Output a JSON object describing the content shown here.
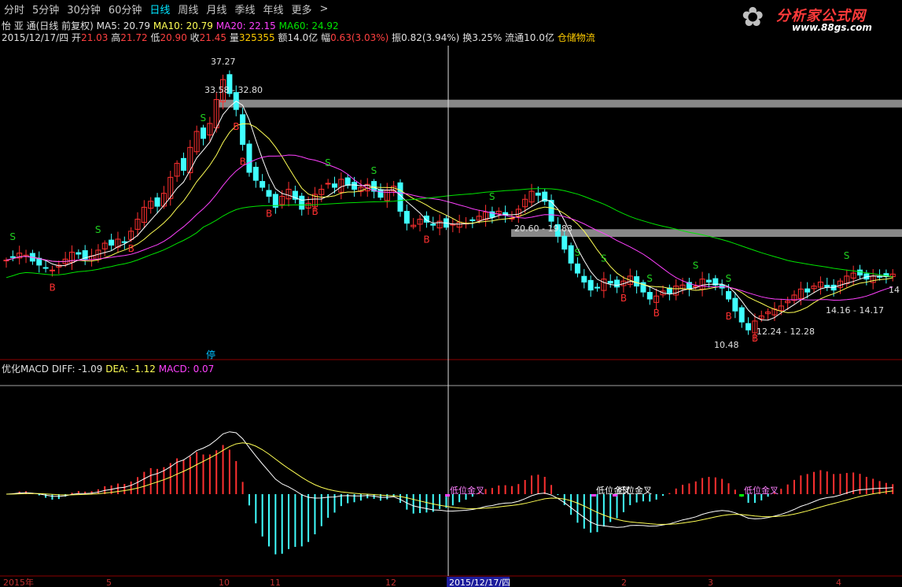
{
  "tabs": [
    {
      "label": "分时",
      "active": false
    },
    {
      "label": "5分钟",
      "active": false
    },
    {
      "label": "30分钟",
      "active": false
    },
    {
      "label": "60分钟",
      "active": false
    },
    {
      "label": "日线",
      "active": true
    },
    {
      "label": "周线",
      "active": false
    },
    {
      "label": "月线",
      "active": false
    },
    {
      "label": "季线",
      "active": false
    },
    {
      "label": "年线",
      "active": false
    },
    {
      "label": "更多",
      "active": false
    },
    {
      "label": ">",
      "active": false
    }
  ],
  "logo": {
    "title": "分析家公式网",
    "url": "www.88gs.com"
  },
  "stock": {
    "name_line": "怡 亚 通(日线 前复权)",
    "ma5": "MA5: 20.79",
    "ma10": "MA10: 20.79",
    "ma20": "MA20: 22.15",
    "ma60": "MA60: 24.92",
    "date": "2015/12/17/四",
    "open_label": "开",
    "open": "21.03",
    "high_label": "高",
    "high": "21.72",
    "low_label": "低",
    "low": "20.90",
    "close_label": "收",
    "close": "21.45",
    "vol_label": "量",
    "vol": "325355",
    "amt_label": "额",
    "amt": "14.0亿",
    "chg_label": "幅",
    "chg": "0.63(3.03%)",
    "amp_label": "振",
    "amp": "0.82(3.94%)",
    "turn_label": "换",
    "turn": "3.25%",
    "float_label": "流通",
    "float": "10.0亿",
    "sector": "仓储物流"
  },
  "macd": {
    "name": "优化MACD",
    "diff": "DIFF: -1.09",
    "dea": "DEA: -1.12",
    "macd": "MACD: 0.07"
  },
  "colors": {
    "up": "#ff3030",
    "down": "#40ffff",
    "ma5": "#ffffff",
    "ma10": "#ffff54",
    "ma20": "#ff40ff",
    "ma60": "#00e400",
    "zone": "#a0a0a0"
  },
  "chart_data": {
    "type": "candlestick",
    "axis_labels": [
      "2015年",
      "5",
      "10",
      "11",
      "12",
      "2015/12/17/四",
      "2",
      "3",
      "4"
    ],
    "price_annotations": [
      "37.27",
      "33.58 - 32.80",
      "20.60 - 19.83",
      "14.16 - 14.17",
      "12.24 - 12.28",
      "10.48",
      "14"
    ],
    "resistance_zones": [
      {
        "from": 32.8,
        "to": 33.58
      },
      {
        "from": 19.83,
        "to": 20.6
      }
    ],
    "signals": {
      "sell_label": "S",
      "buy_label": "B",
      "halt_label": "停"
    },
    "macd_notes": [
      "低位金叉",
      "低位金叉",
      "低位金叉",
      "低位金叉"
    ],
    "ylim_price": [
      9.5,
      39
    ],
    "closes": [
      17.5,
      17.8,
      18.2,
      18.0,
      17.4,
      17.0,
      16.7,
      16.5,
      17.0,
      17.6,
      18.3,
      18.1,
      17.6,
      17.9,
      18.5,
      19.2,
      19.0,
      19.6,
      19.3,
      20.4,
      21.6,
      22.8,
      23.4,
      22.9,
      24.2,
      25.8,
      27.2,
      26.5,
      28.8,
      30.4,
      29.7,
      31.2,
      33.6,
      35.6,
      34.2,
      32.6,
      29.1,
      26.3,
      25.5,
      24.8,
      23.9,
      22.8,
      23.9,
      24.6,
      23.6,
      22.6,
      23.2,
      24.1,
      24.6,
      25.2,
      24.8,
      25.6,
      25.0,
      24.6,
      24.8,
      25.1,
      24.4,
      23.8,
      24.5,
      24.9,
      22.4,
      21.2,
      21.0,
      21.6,
      21.3,
      21.0,
      21.4,
      20.8,
      21.1,
      21.3,
      21.2,
      21.45,
      21.9,
      22.3,
      21.8,
      22.4,
      22.0,
      21.7,
      22.6,
      23.6,
      24.4,
      24.0,
      23.4,
      21.4,
      19.9,
      18.6,
      17.2,
      16.2,
      15.3,
      14.5,
      14.7,
      15.6,
      15.2,
      14.8,
      15.4,
      15.9,
      14.9,
      14.3,
      13.6,
      13.9,
      14.4,
      14.2,
      14.9,
      15.0,
      14.6,
      14.9,
      15.6,
      15.3,
      15.0,
      14.7,
      13.6,
      12.4,
      11.3,
      10.5,
      11.4,
      11.9,
      12.3,
      12.6,
      12.9,
      13.4,
      14.0,
      14.6,
      14.3,
      14.9,
      15.3,
      14.8,
      14.5,
      15.4,
      15.9,
      16.2,
      16.0,
      15.6,
      15.9,
      15.8,
      15.9,
      16.1
    ]
  }
}
